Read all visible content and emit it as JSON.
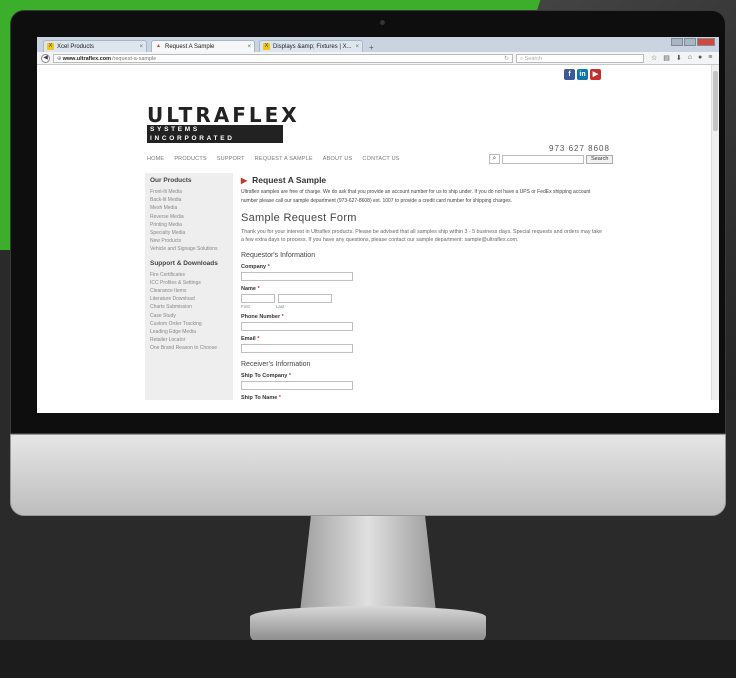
{
  "browser": {
    "tabs": [
      {
        "label": "Xcel Products",
        "active": false
      },
      {
        "label": "Request A Sample",
        "active": true
      },
      {
        "label": "Displays &amp; Fixtures | X...",
        "active": false
      }
    ],
    "url_domain": "www.ultraflex.com",
    "url_path": "/request-a-sample",
    "search_placeholder": "Search"
  },
  "site": {
    "logo_main": "ULTRAFLEX",
    "logo_sub": "SYSTEMS INCORPORATED",
    "phone": "973 627 8608",
    "nav": [
      "HOME",
      "PRODUCTS",
      "SUPPORT",
      "REQUEST A SAMPLE",
      "ABOUT US",
      "CONTACT US"
    ],
    "search_button": "Search"
  },
  "sidebar": {
    "heading1": "Our Products",
    "products": [
      "Front-lit Media",
      "Back-lit Media",
      "Mesh Media",
      "Reverse Media",
      "Printing Media",
      "Specialty Media",
      "New Products",
      "Vehicle and Signage Solutions"
    ],
    "heading2": "Support & Downloads",
    "support": [
      "Fire Certificates",
      "ICC Profiles & Settings",
      "Clearance Items",
      "Literature Download",
      "Charts Submission",
      "Case Study",
      "Custom Order Tracking",
      "Leading Edge Media",
      "Retailer Locator",
      "One Brand Reason to Choose"
    ]
  },
  "content": {
    "title": "Request A Sample",
    "intro": "Ultraflex samples are free of charge. We do ask that you provide an account number for us to ship under. If you do not have a UPS or FedEx shipping account number please call our sample department (973-627-8608) ext. 1007 to provide a credit card number for shipping charges.",
    "form_heading": "Sample Request Form",
    "form_desc": "Thank you for your interest in Ultraflex products. Please be advised that all samples ship within 3 - 5 business days. Special requests and orders may take a few extra days to process. If you have any questions, please contact our sample department: sample@ultraflex.com.",
    "requestor_heading": "Requestor's Information",
    "company_label": "Company",
    "name_label": "Name",
    "first_label": "First",
    "last_label": "Last",
    "phone_label": "Phone Number",
    "email_label": "Email",
    "receiver_heading": "Receiver's Information",
    "ship_company_label": "Ship To Company",
    "ship_name_label": "Ship To Name",
    "required_mark": "*"
  }
}
